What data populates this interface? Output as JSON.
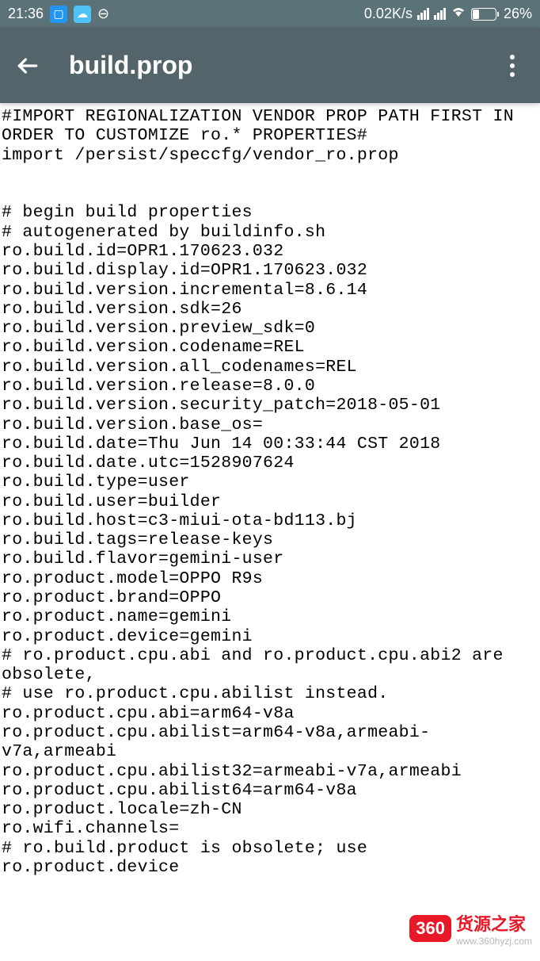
{
  "status_bar": {
    "time": "21:36",
    "data_speed": "0.02K/s",
    "battery_pct": "26%"
  },
  "app_bar": {
    "title": "build.prop"
  },
  "file_content": "#IMPORT REGIONALIZATION VENDOR PROP PATH FIRST IN ORDER TO CUSTOMIZE ro.* PROPERTIES#\nimport /persist/speccfg/vendor_ro.prop\n\n\n# begin build properties\n# autogenerated by buildinfo.sh\nro.build.id=OPR1.170623.032\nro.build.display.id=OPR1.170623.032\nro.build.version.incremental=8.6.14\nro.build.version.sdk=26\nro.build.version.preview_sdk=0\nro.build.version.codename=REL\nro.build.version.all_codenames=REL\nro.build.version.release=8.0.0\nro.build.version.security_patch=2018-05-01\nro.build.version.base_os=\nro.build.date=Thu Jun 14 00:33:44 CST 2018\nro.build.date.utc=1528907624\nro.build.type=user\nro.build.user=builder\nro.build.host=c3-miui-ota-bd113.bj\nro.build.tags=release-keys\nro.build.flavor=gemini-user\nro.product.model=OPPO R9s\nro.product.brand=OPPO\nro.product.name=gemini\nro.product.device=gemini\n# ro.product.cpu.abi and ro.product.cpu.abi2 are obsolete,\n# use ro.product.cpu.abilist instead.\nro.product.cpu.abi=arm64-v8a\nro.product.cpu.abilist=arm64-v8a,armeabi-v7a,armeabi\nro.product.cpu.abilist32=armeabi-v7a,armeabi\nro.product.cpu.abilist64=arm64-v8a\nro.product.locale=zh-CN\nro.wifi.channels=\n# ro.build.product is obsolete; use ro.product.device",
  "watermark": {
    "badge": "360",
    "main": "货源之家",
    "sub": "www.360hyzj.com"
  }
}
